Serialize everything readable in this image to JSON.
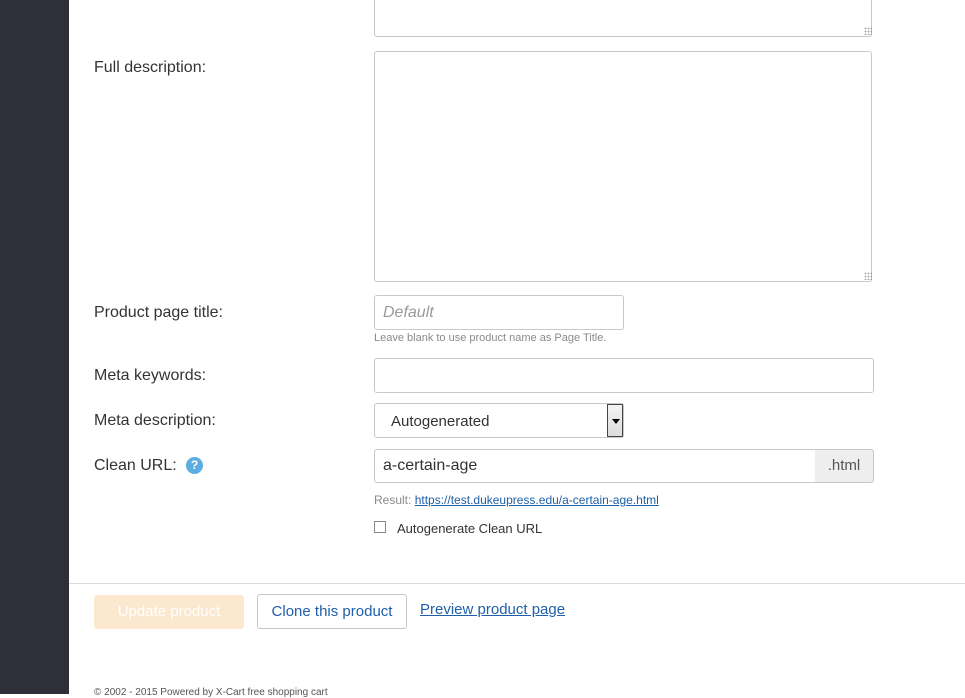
{
  "form": {
    "full_description": {
      "label": "Full description:"
    },
    "page_title": {
      "label": "Product page title:",
      "placeholder": "Default",
      "hint": "Leave blank to use product name as Page Title."
    },
    "meta_keywords": {
      "label": "Meta keywords:",
      "value": ""
    },
    "meta_description": {
      "label": "Meta description:",
      "selected": "Autogenerated"
    },
    "clean_url": {
      "label": "Clean URL:",
      "help_glyph": "?",
      "value": "a-certain-age",
      "suffix": ".html",
      "result_label": "Result:",
      "result_url": "https://test.dukeupress.edu/a-certain-age.html",
      "autogenerate_label": "Autogenerate Clean URL",
      "autogenerate_checked": false
    }
  },
  "actions": {
    "update": "Update product",
    "clone": "Clone this product",
    "preview": "Preview product page"
  },
  "footer": {
    "text": "© 2002 - 2015 Powered by X-Cart free shopping cart"
  },
  "colors": {
    "sidebar": "#2f2f3a",
    "link": "#1f5fa8",
    "help_icon": "#5aaee0",
    "update_button_disabled": "#fbe8cf"
  }
}
